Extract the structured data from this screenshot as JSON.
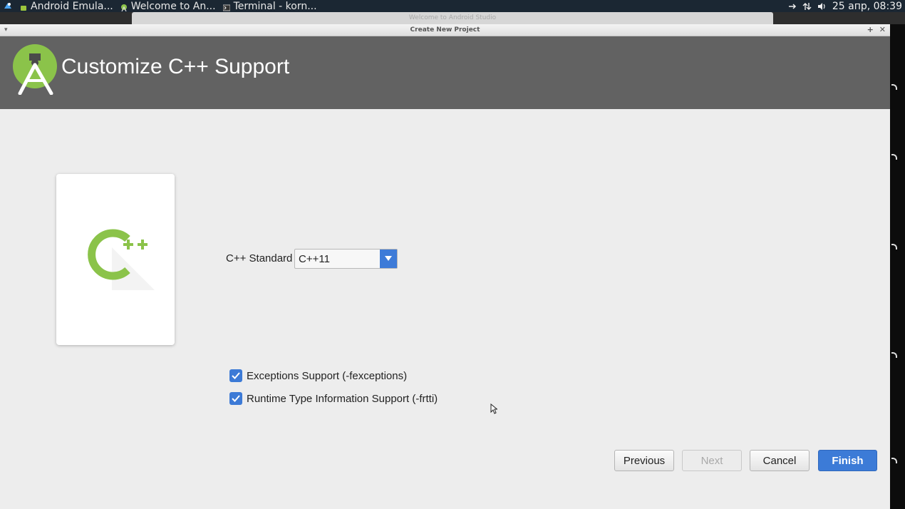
{
  "taskbar": {
    "tasks": [
      "Android Emula...",
      "Welcome to An...",
      "Terminal - korn..."
    ],
    "clock": "25 апр, 08:39"
  },
  "background_window": {
    "title": "Welcome to Android Studio"
  },
  "dialog": {
    "title": "Create New Project",
    "header_title": "Customize C++ Support",
    "card_icon": "cpp-logo",
    "cpp_standard_label": "C++ Standard",
    "cpp_standard_value": "C++11",
    "checkboxes": [
      {
        "label": "Exceptions Support (-fexceptions)",
        "checked": true
      },
      {
        "label": "Runtime Type Information Support (-frtti)",
        "checked": true
      }
    ],
    "buttons": {
      "previous": "Previous",
      "next": "Next",
      "cancel": "Cancel",
      "finish": "Finish"
    }
  },
  "colors": {
    "header_bg": "#626262",
    "accent_blue": "#3c7bd7",
    "android_green": "#8bc34a"
  }
}
